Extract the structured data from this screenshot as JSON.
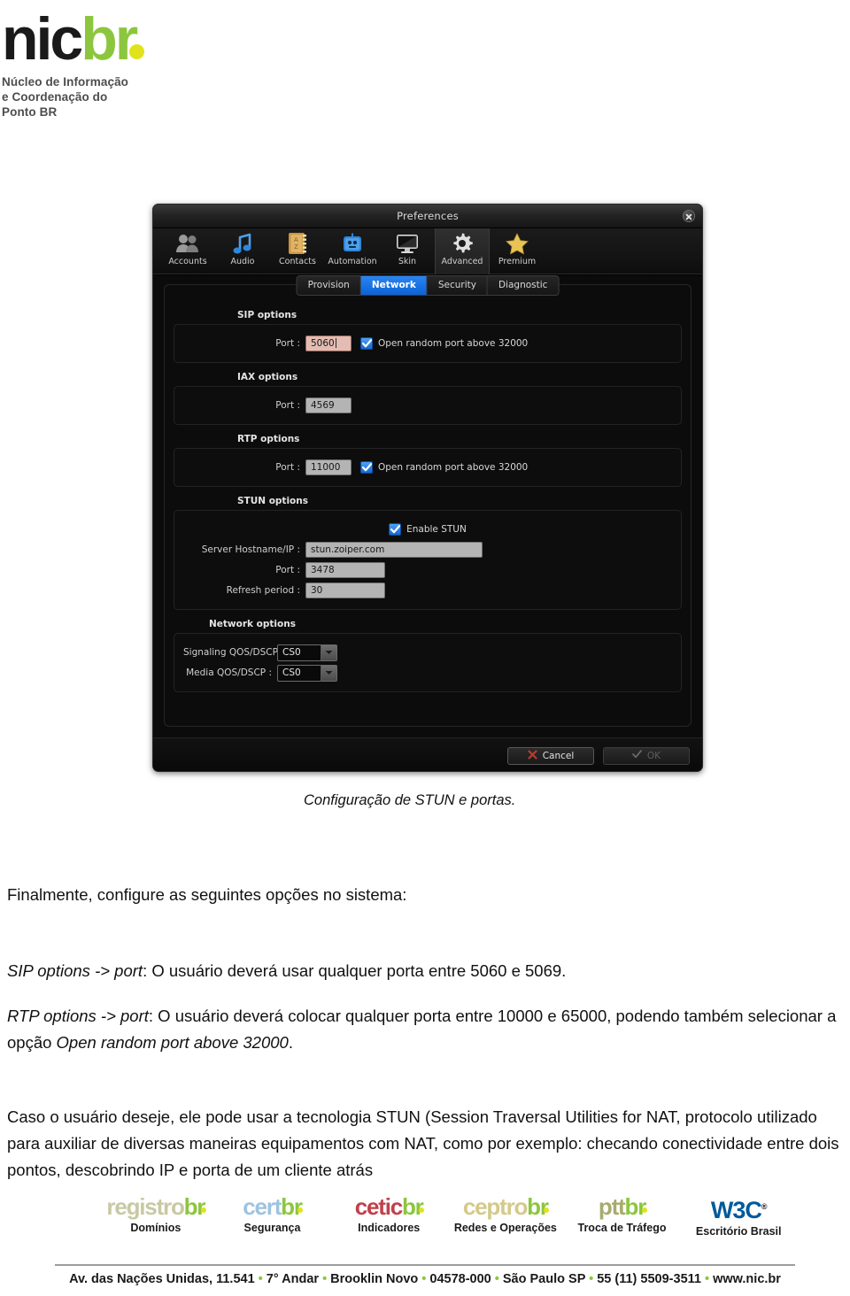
{
  "brand": {
    "logo_nic": "nic",
    "logo_br": "br",
    "tagline_line1": "Núcleo de Informação",
    "tagline_line2": "e Coordenação do",
    "tagline_line3": "Ponto BR",
    "green": "#8cc63e",
    "yellow": "#e2e21c"
  },
  "dialog": {
    "title": "Preferences",
    "close_icon": "close-icon",
    "toolbar": [
      {
        "label": "Accounts",
        "icon": "accounts-icon",
        "selected": false
      },
      {
        "label": "Audio",
        "icon": "audio-note-icon",
        "selected": false
      },
      {
        "label": "Contacts",
        "icon": "contacts-book-icon",
        "selected": false
      },
      {
        "label": "Automation",
        "icon": "automation-robot-icon",
        "selected": false
      },
      {
        "label": "Skin",
        "icon": "skin-monitor-icon",
        "selected": false
      },
      {
        "label": "Advanced",
        "icon": "gear-icon",
        "selected": true
      },
      {
        "label": "Premium",
        "icon": "star-icon",
        "selected": false
      }
    ],
    "tabs": [
      {
        "label": "Provision",
        "active": false
      },
      {
        "label": "Network",
        "active": true
      },
      {
        "label": "Security",
        "active": false
      },
      {
        "label": "Diagnostic",
        "active": false
      }
    ],
    "active_tab_color": "#0c63d6",
    "groups": {
      "sip": {
        "title": "SIP options",
        "port_label": "Port :",
        "port_value": "5060",
        "port_focused": true,
        "checkbox_label": "Open random port above 32000",
        "checkbox_checked": true
      },
      "iax": {
        "title": "IAX options",
        "port_label": "Port :",
        "port_value": "4569"
      },
      "rtp": {
        "title": "RTP options",
        "port_label": "Port :",
        "port_value": "11000",
        "checkbox_label": "Open random port above 32000",
        "checkbox_checked": true
      },
      "stun": {
        "title": "STUN options",
        "enable_label": "Enable STUN",
        "enable_checked": true,
        "host_label": "Server Hostname/IP :",
        "host_value": "stun.zoiper.com",
        "port_label": "Port :",
        "port_value": "3478",
        "refresh_label": "Refresh period :",
        "refresh_value": "30"
      },
      "network": {
        "title": "Network options",
        "signaling_label": "Signaling QOS/DSCP :",
        "signaling_value": "CS0",
        "media_label": "Media QOS/DSCP :",
        "media_value": "CS0"
      }
    },
    "buttons": {
      "cancel": "Cancel",
      "ok": "OK",
      "ok_disabled": true
    }
  },
  "caption": "Configuração de STUN e portas.",
  "body": {
    "p1": "Finalmente, configure as seguintes opções no sistema:",
    "p2_em": "SIP options -> port",
    "p2_rest": ": O usuário deverá usar qualquer porta entre 5060 e 5069.",
    "p3_em": "RTP options -> port",
    "p3_mid": ": O usuário deverá colocar qualquer porta entre 10000 e 65000, podendo também selecionar a opção ",
    "p3_em2": "Open random port above 32000",
    "p3_end": ".",
    "p4": "Caso o usuário deseje, ele pode usar a tecnologia STUN (Session Traversal Utilities for NAT, protocolo utilizado para auxiliar de diversas maneiras equipamentos com NAT, como por exemplo: checando conectividade entre dois pontos, descobrindo IP e porta de um cliente atrás"
  },
  "footer": {
    "logos": [
      {
        "name": "registro",
        "suffix": "br",
        "sub": "Domínios",
        "color": "#c8c9a4"
      },
      {
        "name": "cert",
        "suffix": "br",
        "sub": "Segurança",
        "color": "#9dc3e0"
      },
      {
        "name": "cetic",
        "suffix": "br",
        "sub": "Indicadores",
        "color": "#c1404a"
      },
      {
        "name": "ceptro",
        "suffix": "br",
        "sub": "Redes e Operações",
        "color": "#d4c98a"
      },
      {
        "name": "ptt",
        "suffix": "br",
        "sub": "Troca de Tráfego",
        "color": "#a8ab6e"
      }
    ],
    "w3c": {
      "mark": "W3C",
      "sub": "Escritório Brasil"
    },
    "address": "Av. das Nações Unidas, 11.541 • 7° Andar • Brooklin Novo • 04578-000 • São Paulo SP • 55 (11) 5509-3511 • www.nic.br"
  }
}
